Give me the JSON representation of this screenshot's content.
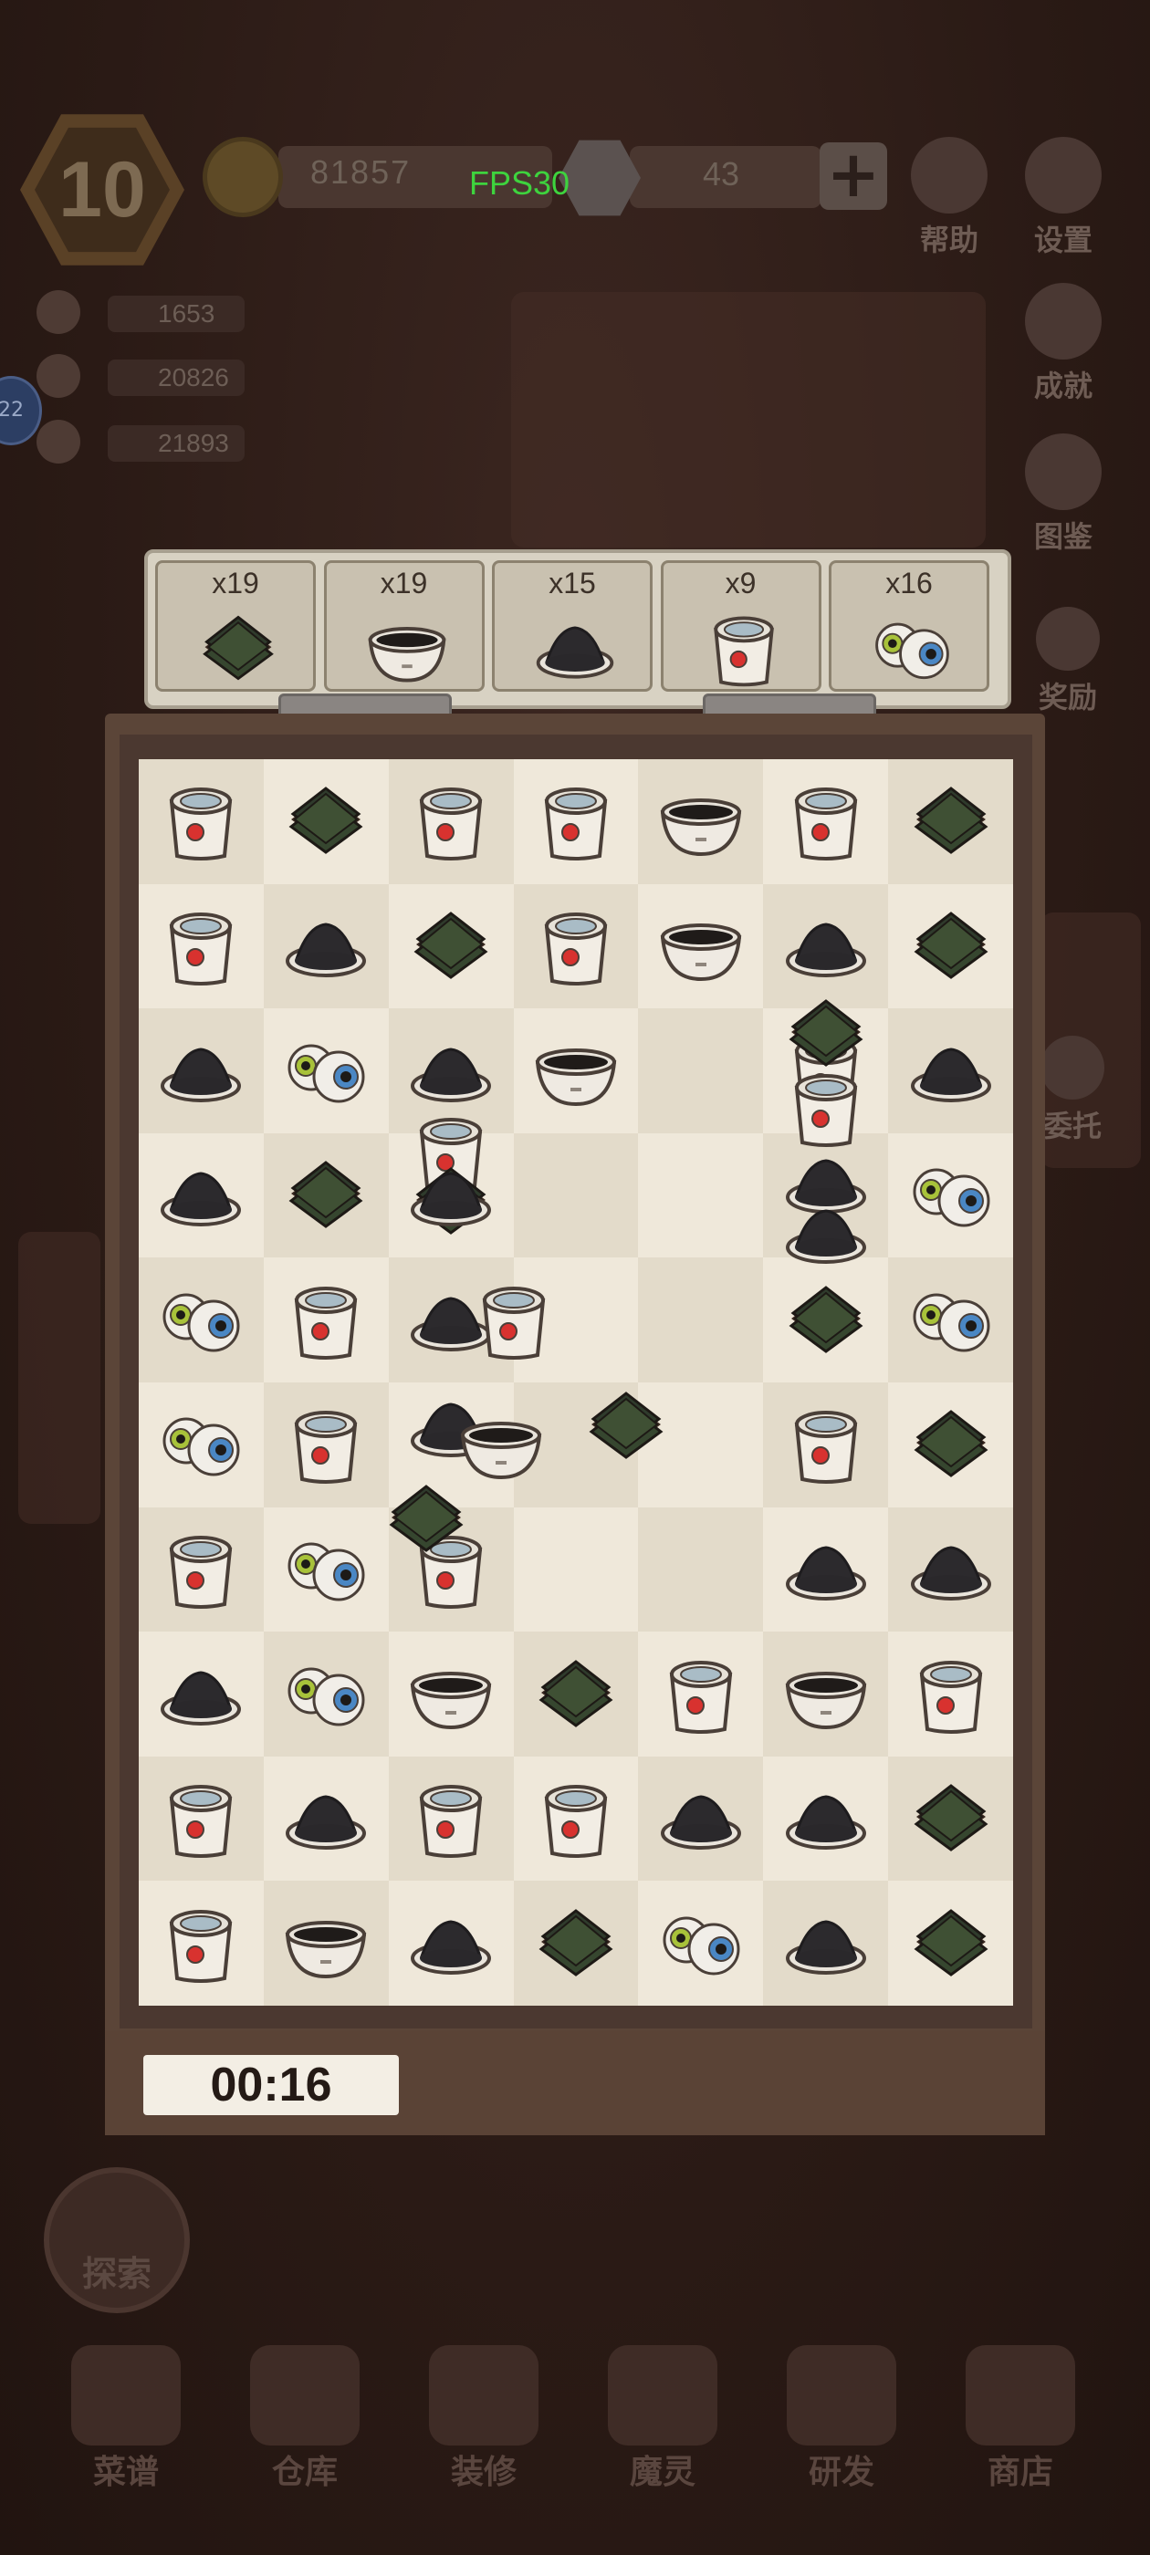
{
  "hud": {
    "level": "10",
    "coins": "81857",
    "gems": "43",
    "plus_label": "+",
    "fps": "FPS30"
  },
  "side_buttons": {
    "help": "帮助",
    "settings": "设置",
    "achievements": "成就",
    "gallery": "图鉴",
    "reward": "奖励",
    "delegate": "委托"
  },
  "stats": [
    "1653",
    "20826",
    "21893"
  ],
  "mail_badge": "22",
  "goals": [
    {
      "count": "x19",
      "item": "seaweed"
    },
    {
      "count": "x19",
      "item": "soy-bowl"
    },
    {
      "count": "x15",
      "item": "ash-dish"
    },
    {
      "count": "x9",
      "item": "cup"
    },
    {
      "count": "x16",
      "item": "eyeballs"
    }
  ],
  "board": {
    "rows": [
      [
        "cup",
        "seaweed",
        "cup",
        "cup",
        "soy-bowl",
        "cup",
        "seaweed"
      ],
      [
        "cup",
        "ash-dish",
        "seaweed",
        "cup",
        "soy-bowl",
        "ash-dish",
        "seaweed"
      ],
      [
        "ash-dish",
        "eyeballs",
        "ash-dish",
        "soy-bowl",
        "",
        "",
        "ash-dish"
      ],
      [
        "ash-dish",
        "seaweed",
        "",
        "",
        "",
        "",
        "eyeballs"
      ],
      [
        "eyeballs",
        "cup",
        "",
        "",
        "",
        "seaweed",
        "eyeballs"
      ],
      [
        "eyeballs",
        "cup",
        "",
        "",
        "",
        "cup",
        "seaweed"
      ],
      [
        "cup",
        "eyeballs",
        "cup",
        "",
        "",
        "ash-dish",
        "ash-dish"
      ],
      [
        "ash-dish",
        "eyeballs",
        "soy-bowl",
        "seaweed",
        "cup",
        "soy-bowl",
        "cup"
      ],
      [
        "cup",
        "ash-dish",
        "cup",
        "cup",
        "ash-dish",
        "ash-dish",
        "seaweed"
      ],
      [
        "cup",
        "soy-bowl",
        "ash-dish",
        "seaweed",
        "eyeballs",
        "ash-dish",
        "seaweed"
      ]
    ],
    "falling": [
      {
        "item": "cup",
        "col": 5,
        "row": 2
      },
      {
        "item": "seaweed",
        "col": 5,
        "row": 1.7
      },
      {
        "item": "cup",
        "col": 5,
        "row": 2.3
      },
      {
        "item": "cup",
        "col": 2,
        "row": 2.65
      },
      {
        "item": "seaweed",
        "col": 2,
        "row": 3.05
      },
      {
        "item": "ash-dish",
        "col": 2,
        "row": 3.0
      },
      {
        "item": "ash-dish",
        "col": 5,
        "row": 2.9
      },
      {
        "item": "ash-dish",
        "col": 5,
        "row": 3.3
      },
      {
        "item": "ash-dish",
        "col": 2,
        "row": 4.0
      },
      {
        "item": "cup",
        "col": 2.5,
        "row": 4.0
      },
      {
        "item": "seaweed",
        "col": 3.4,
        "row": 4.85
      },
      {
        "item": "ash-dish",
        "col": 2,
        "row": 4.85
      },
      {
        "item": "soy-bowl",
        "col": 2.4,
        "row": 5.0
      },
      {
        "item": "seaweed",
        "col": 1.8,
        "row": 5.6
      }
    ]
  },
  "timer": "00:16",
  "explore_label": "探索",
  "nav": [
    "菜谱",
    "仓库",
    "装修",
    "魔灵",
    "研发",
    "商店"
  ],
  "colors": {
    "board_light": "#efe8da",
    "board_dark": "#e3dbca",
    "fps_green": "#3ed33e"
  }
}
